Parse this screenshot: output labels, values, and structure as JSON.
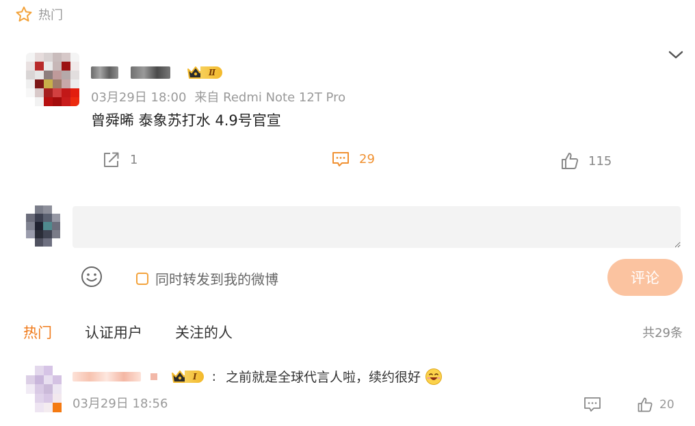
{
  "section": {
    "icon": "star-icon",
    "label": "热门"
  },
  "post": {
    "vip_level": "Ⅱ",
    "time": "03月29日 18:00",
    "source": "来自 Redmi Note 12T Pro",
    "text": "曾舜晞 泰象苏打水 4.9号官宣",
    "repost_count": "1",
    "comment_count": "29",
    "like_count": "115"
  },
  "composer": {
    "repost_label": "同时转发到我的微博",
    "submit_label": "评论"
  },
  "tabs": [
    {
      "label": "热门",
      "active": true
    },
    {
      "label": "认证用户",
      "active": false
    },
    {
      "label": "关注的人",
      "active": false
    }
  ],
  "total_count": "共29条",
  "comment": {
    "vip_level": "Ⅰ",
    "separator": ":",
    "text": "之前就是全球代言人啦，续约很好",
    "time": "03月29日 18:56",
    "like_count": "20"
  },
  "colors": {
    "accent": "#f07a1a",
    "comment_action": "#f09030",
    "submit_bg": "#fbc3a0",
    "badge_gold": "#f3b92b"
  }
}
